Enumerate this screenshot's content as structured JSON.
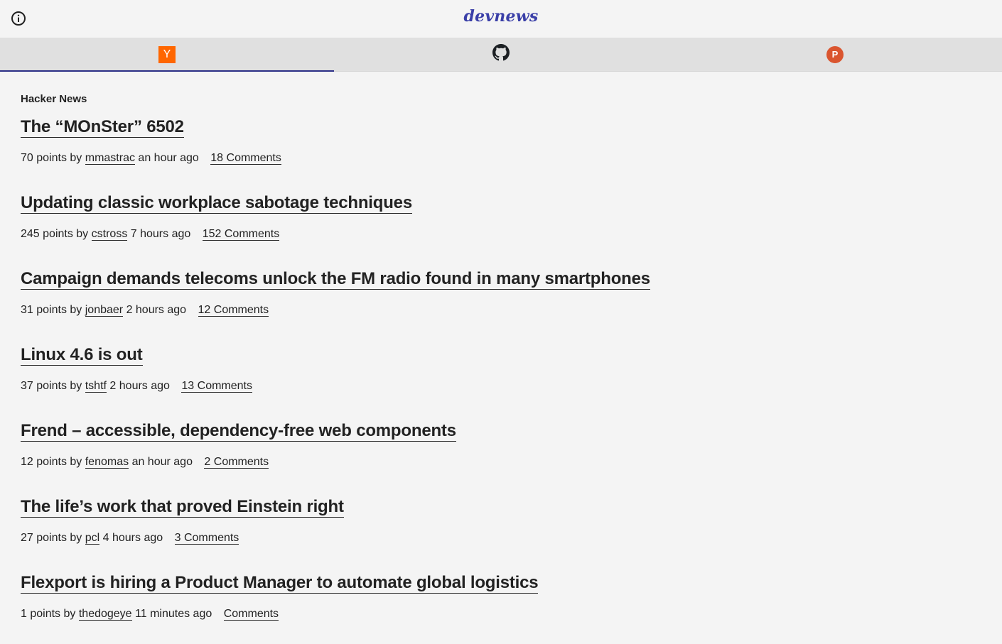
{
  "app": {
    "brand": "devnews"
  },
  "tabs": [
    {
      "name": "hacker-news",
      "icon": "y-combinator-icon",
      "glyph": "Y",
      "active": true
    },
    {
      "name": "github",
      "icon": "github-icon",
      "active": false
    },
    {
      "name": "product-hunt",
      "icon": "product-hunt-icon",
      "glyph": "P",
      "active": false
    }
  ],
  "colors": {
    "brand": "#3a3fa8",
    "tab_indicator": "#2b2f86",
    "hn_orange": "#ff6600",
    "ph_red": "#da552f"
  },
  "feed": {
    "section_title": "Hacker News",
    "stories": [
      {
        "title": "The “MOnSter” 6502",
        "points_prefix": "70 points by",
        "user": "mmastrac",
        "age": "an hour ago",
        "comments": "18 Comments"
      },
      {
        "title": "Updating classic workplace sabotage techniques",
        "points_prefix": "245 points by",
        "user": "cstross",
        "age": "7 hours ago",
        "comments": "152 Comments"
      },
      {
        "title": "Campaign demands telecoms unlock the FM radio found in many smartphones",
        "points_prefix": "31 points by",
        "user": "jonbaer",
        "age": "2 hours ago",
        "comments": "12 Comments"
      },
      {
        "title": "Linux 4.6 is out",
        "points_prefix": "37 points by",
        "user": "tshtf",
        "age": "2 hours ago",
        "comments": "13 Comments"
      },
      {
        "title": "Frend – accessible, dependency-free web components",
        "points_prefix": "12 points by",
        "user": "fenomas",
        "age": "an hour ago",
        "comments": "2 Comments"
      },
      {
        "title": "The life’s work that proved Einstein right",
        "points_prefix": "27 points by",
        "user": "pcl",
        "age": "4 hours ago",
        "comments": "3 Comments"
      },
      {
        "title": "Flexport is hiring a Product Manager to automate global logistics",
        "points_prefix": "1 points by",
        "user": "thedogeye",
        "age": "11 minutes ago",
        "comments": "Comments"
      }
    ]
  }
}
